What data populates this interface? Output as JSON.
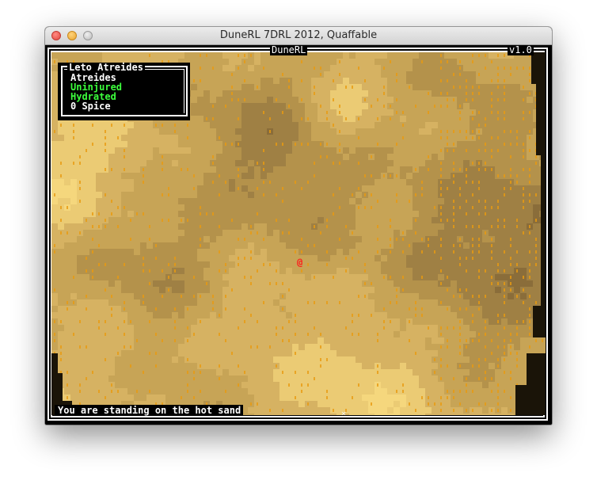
{
  "window": {
    "title": "DuneRL 7DRL 2012, Quaffable"
  },
  "console": {
    "title": "DuneRL",
    "version": "v1.0"
  },
  "status_panel": {
    "character_name": "Leto Atreides",
    "house": "Atreides",
    "health": "Uninjured",
    "water": "Hydrated",
    "spice": "0 Spice",
    "colors": {
      "name": "#ffffff",
      "house": "#ffffff",
      "health": "#3cff3c",
      "water": "#3cff3c",
      "spice": "#ffffff"
    }
  },
  "map": {
    "player_glyph": "@",
    "player_color": "#ff1a1a",
    "sand_colors": [
      "#f5d77d",
      "#ebcb74",
      "#d6b262",
      "#c7a456",
      "#b4924b",
      "#9f8044",
      "#8a6d3a"
    ],
    "spice_color": "#e89a10",
    "dark_edge_color": "#1a1408"
  },
  "message_log": {
    "text": "You are standing on the hot sand"
  }
}
